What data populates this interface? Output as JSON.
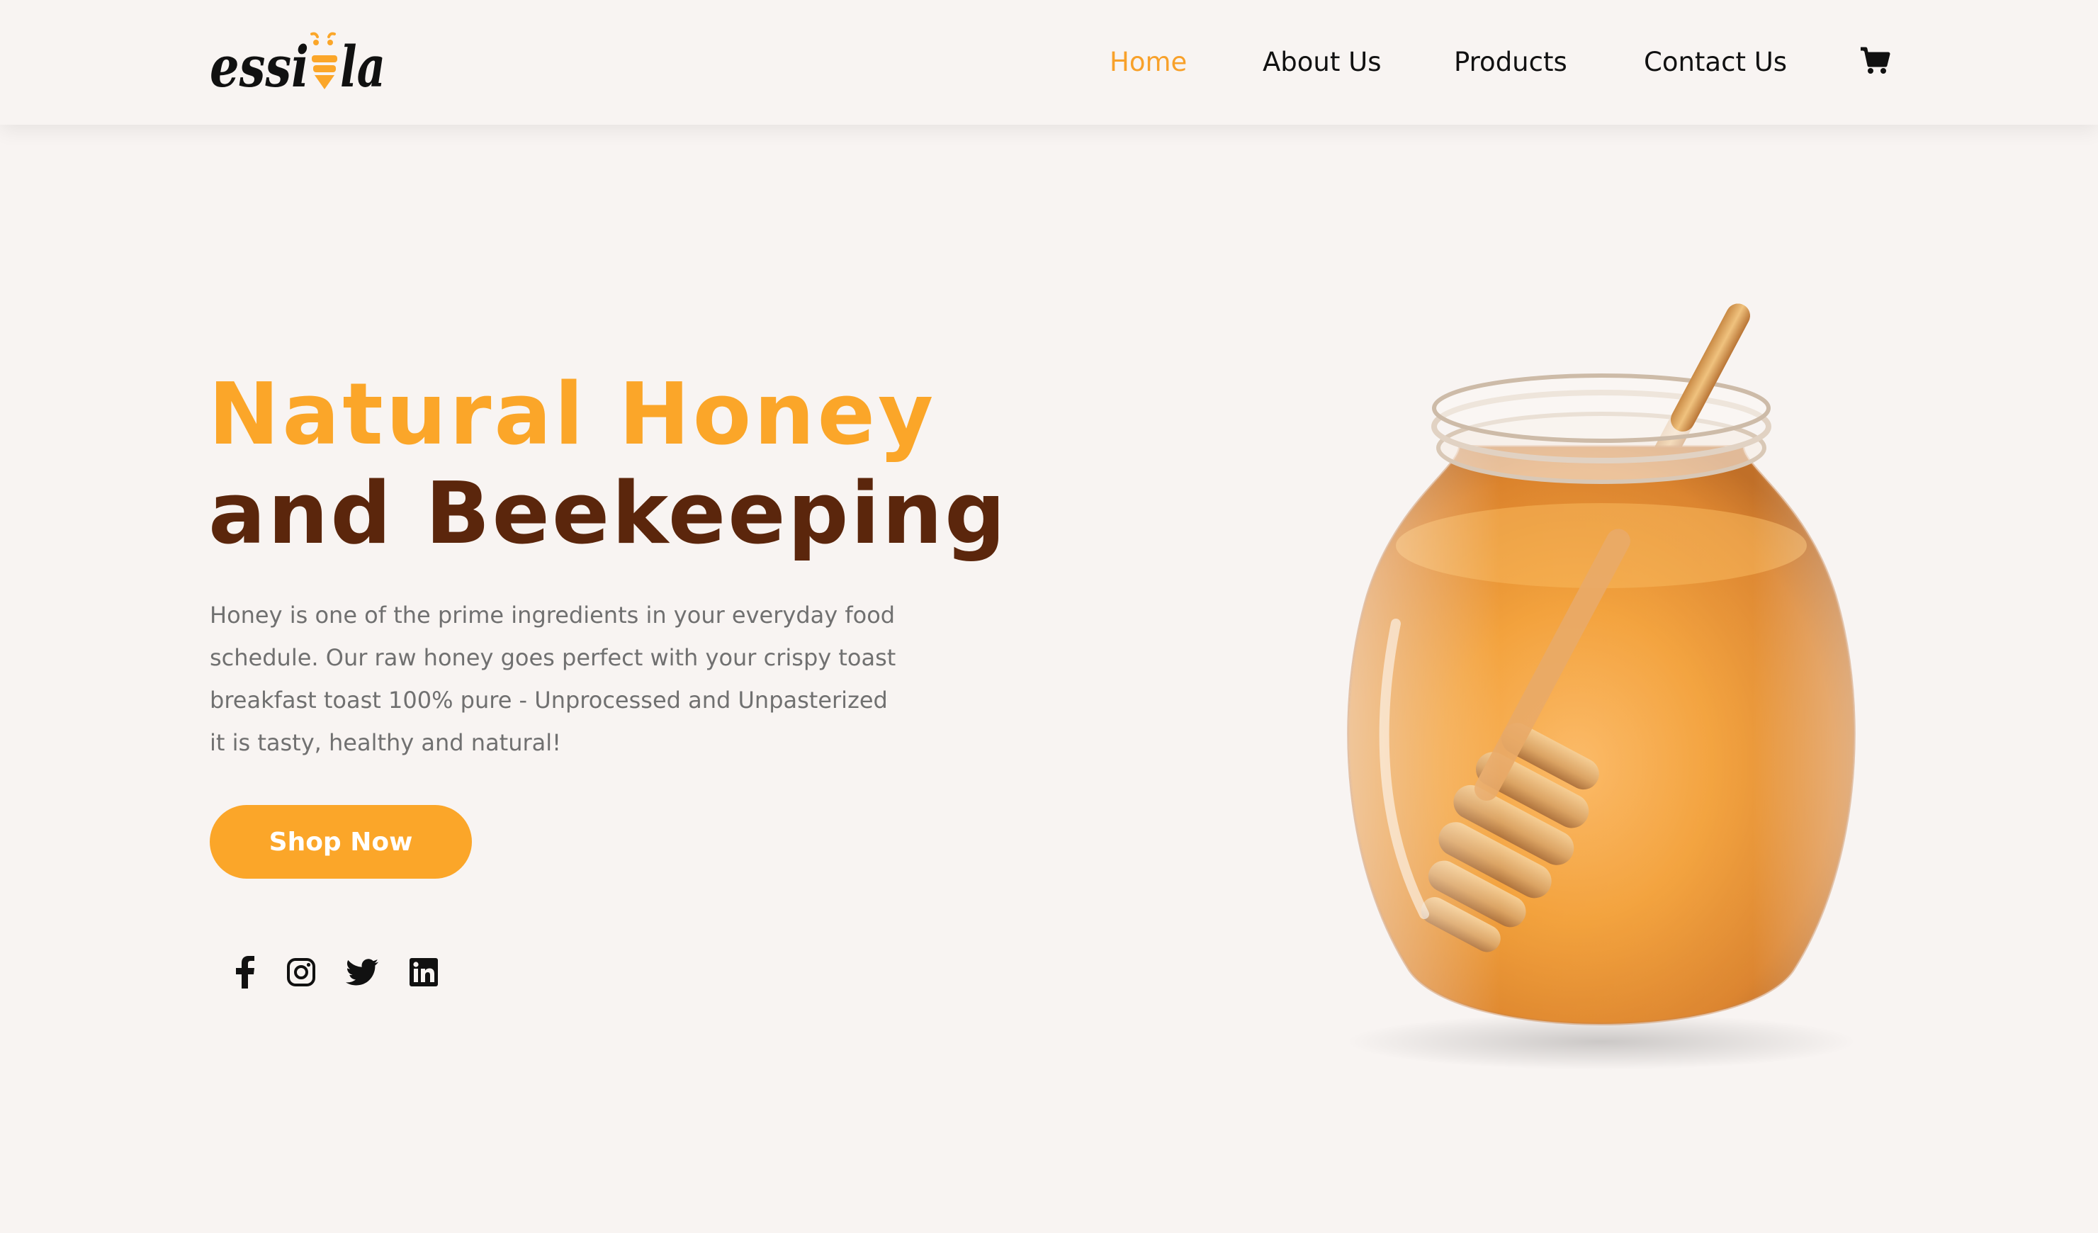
{
  "brand": {
    "logo_text": "essila",
    "accent": "#fba629",
    "dark_brown": "#5b260c"
  },
  "nav": {
    "items": [
      {
        "label": "Home",
        "active": true
      },
      {
        "label": "About Us",
        "active": false
      },
      {
        "label": "Products",
        "active": false
      },
      {
        "label": "Contact Us",
        "active": false
      }
    ],
    "cart_icon": "shopping-cart-icon"
  },
  "hero": {
    "title_line1": "Natural Honey",
    "title_line2": "and Beekeeping",
    "description_lines": [
      "Honey is one of the prime ingredients in your everyday food",
      "schedule. Our raw honey goes perfect with your crispy toast",
      "breakfast toast 100% pure - Unprocessed and Unpasterized",
      "it is tasty, healthy and natural!"
    ],
    "cta_label": "Shop Now",
    "image_icon": "honey-jar-with-dipper"
  },
  "social": [
    "facebook-icon",
    "instagram-icon",
    "twitter-icon",
    "linkedin-icon"
  ]
}
